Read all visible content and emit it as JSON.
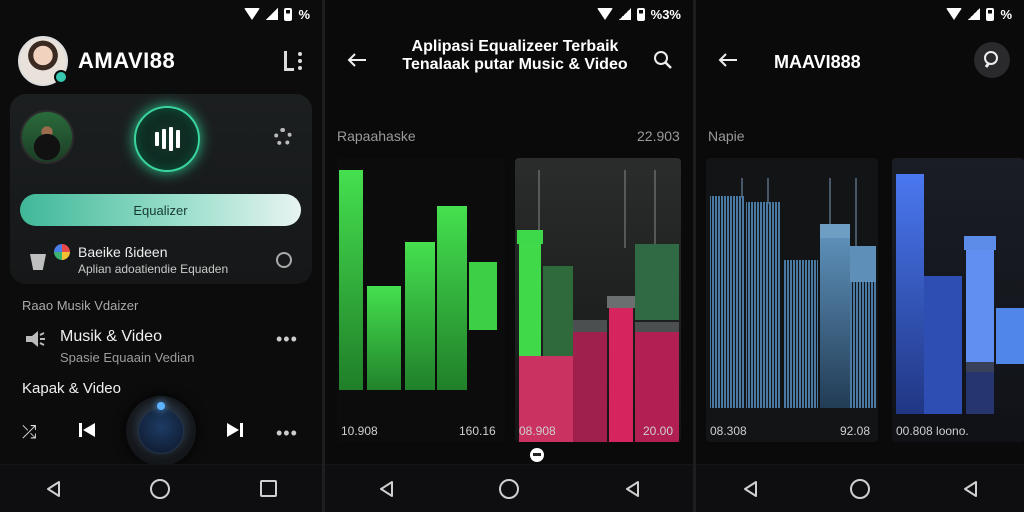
{
  "status": {
    "s1": "%",
    "s2": "%3%",
    "s3": "%"
  },
  "screen1": {
    "app_title": "AMAVI88",
    "equalizer_button": "Equalizer",
    "card_row": {
      "title": "Baeike ßideen",
      "subtitle": "Aplian adoatiendie Equaden"
    },
    "section_label": "Raao Musik Vdaizer",
    "item": {
      "title": "Musik & Video",
      "subtitle": "Spasie Equaain Vedian"
    },
    "player_label": "Kapak & Video",
    "icons": [
      "menu-icon",
      "gear-icon",
      "shuffle-icon",
      "prev-icon",
      "next-icon",
      "more-icon"
    ]
  },
  "screen2": {
    "title_line1": "Aplipasi Equalizeer Terbaik",
    "title_line2": "Tenalaak putar Music & Video",
    "panel_left_label": "Rapaahaske",
    "panel_right_label": "22.903",
    "left_bottom_a": "10.908",
    "left_bottom_b": "160.16",
    "right_bottom_a": "08.908",
    "right_bottom_b": "20.00",
    "colors": {
      "green": "#3fd94a",
      "pink": "#d6245e",
      "dark_green": "#2f6a44"
    }
  },
  "screen3": {
    "title": "MAAVI888",
    "panel_label": "Napie",
    "left_bottom_a": "08.308",
    "left_bottom_b": "92.08",
    "right_bottom": "00.808 loono.",
    "colors": {
      "steel_blue": "#3f6f96",
      "royal_blue": "#3d63d8"
    }
  }
}
